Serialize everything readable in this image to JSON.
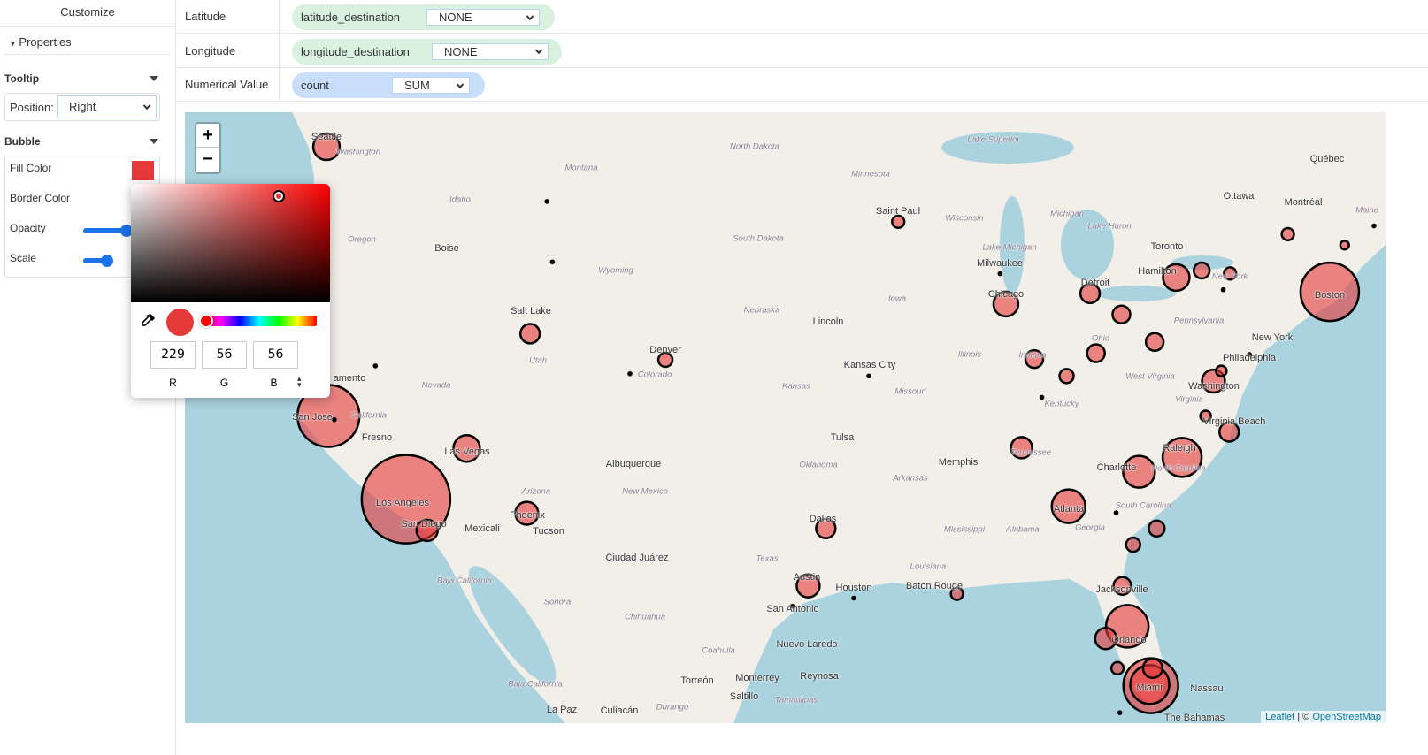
{
  "sidebar": {
    "customize": "Customize",
    "properties": "Properties",
    "tooltip": {
      "title": "Tooltip",
      "position_label": "Position:",
      "position_value": "Right"
    },
    "bubble": {
      "title": "Bubble",
      "fill_color_label": "Fill Color",
      "border_color_label": "Border Color",
      "opacity_label": "Opacity",
      "scale_label": "Scale",
      "fill_color": "#e53838",
      "opacity": 0.9,
      "scale": 0.45
    }
  },
  "fields": [
    {
      "label": "Latitude",
      "field": "latitude_destination",
      "agg": "NONE",
      "color": "#d9f2e0"
    },
    {
      "label": "Longitude",
      "field": "longitude_destination",
      "agg": "NONE",
      "color": "#d9f2e0"
    },
    {
      "label": "Numerical Value",
      "field": "count",
      "agg": "SUM",
      "color": "#c9defa"
    }
  ],
  "picker": {
    "r": "229",
    "g": "56",
    "b": "56",
    "r_label": "R",
    "g_label": "G",
    "b_label": "B",
    "mode_icon": "updown-icon"
  },
  "map": {
    "zoom_in": "+",
    "zoom_out": "−",
    "attribution_leaflet": "Leaflet",
    "attribution_sep": " | © ",
    "attribution_osm": "OpenStreetMap",
    "cities": [
      "Seattle",
      "Boise",
      "Salt Lake",
      "amento",
      "San Jose",
      "Fresno",
      "Las Vegas",
      "Los Angeles",
      "Mexicali",
      "Phoenix",
      "Tucson",
      "Albuquerque",
      "Denver",
      "Ciudad Juárez",
      "Lincoln",
      "Kansas City",
      "Tulsa",
      "Dallas",
      "Austin",
      "Houston",
      "San Antonio",
      "Nuevo Laredo",
      "Monterrey",
      "Reynosa",
      "Torreón",
      "Saltillo",
      "Culiacán",
      "La Paz",
      "Memphis",
      "Baton Rouge",
      "Jacksonville",
      "Atlanta",
      "Charlotte",
      "Raleigh",
      "Virginia Beach",
      "Washington",
      "Philadelphia",
      "New York",
      "Boston",
      "Chicago",
      "Milwaukee",
      "Detroit",
      "Toronto",
      "Hamilton",
      "Ottawa",
      "Montréal",
      "Québec",
      "Saint Paul",
      "Nassau",
      "The Bahamas",
      "Orlando",
      "Miami",
      "San Diego"
    ],
    "regions": [
      "Washington",
      "Oregon",
      "Idaho",
      "Montana",
      "North Dakota",
      "South Dakota",
      "Wyoming",
      "Nebraska",
      "Utah",
      "Colorado",
      "Nevada",
      "California",
      "Arizona",
      "New Mexico",
      "Kansas",
      "Oklahoma",
      "Texas",
      "Minnesota",
      "Iowa",
      "Wisconsin",
      "Michigan",
      "Illinois",
      "Missouri",
      "Arkansas",
      "Mississippi",
      "Alabama",
      "Louisiana",
      "Kentucky",
      "Tennessee",
      "Georgia",
      "Ohio",
      "Indiana",
      "Pennsylvania",
      "West Virginia",
      "Virginia",
      "North Carolina",
      "South Carolina",
      "New York",
      "Maine",
      "Baja California",
      "Sonora",
      "Chihuahua",
      "Coahuila",
      "Durango",
      "Tamaulipas",
      "Baja California",
      "Lake Superior",
      "Lake Michigan",
      "Lake Huron"
    ],
    "bubbles": [
      {
        "lat": 47.6,
        "lon": -122.3,
        "count": 56
      },
      {
        "lat": 37.5,
        "lon": -122.2,
        "count": 306
      },
      {
        "lat": 34.05,
        "lon": -118.24,
        "count": 625
      },
      {
        "lat": 32.72,
        "lon": -117.16,
        "count": 36
      },
      {
        "lat": 36.17,
        "lon": -115.14,
        "count": 56
      },
      {
        "lat": 40.76,
        "lon": -111.9,
        "count": 30
      },
      {
        "lat": 33.45,
        "lon": -112.07,
        "count": 42
      },
      {
        "lat": 39.74,
        "lon": -104.99,
        "count": 16
      },
      {
        "lat": 44.95,
        "lon": -93.1,
        "count": 12
      },
      {
        "lat": 41.9,
        "lon": -87.6,
        "count": 49
      },
      {
        "lat": 42.3,
        "lon": -83.3,
        "count": 30
      },
      {
        "lat": 41.5,
        "lon": -81.7,
        "count": 25
      },
      {
        "lat": 40.0,
        "lon": -83.0,
        "count": 25
      },
      {
        "lat": 39.77,
        "lon": -86.15,
        "count": 25
      },
      {
        "lat": 39.1,
        "lon": -84.5,
        "count": 16
      },
      {
        "lat": 40.44,
        "lon": -80.0,
        "count": 25
      },
      {
        "lat": 42.9,
        "lon": -78.9,
        "count": 56
      },
      {
        "lat": 43.16,
        "lon": -77.6,
        "count": 20
      },
      {
        "lat": 43.05,
        "lon": -76.15,
        "count": 12
      },
      {
        "lat": 44.5,
        "lon": -73.2,
        "count": 12
      },
      {
        "lat": 44.1,
        "lon": -70.3,
        "count": 6
      },
      {
        "lat": 42.36,
        "lon": -71.06,
        "count": 272
      },
      {
        "lat": 38.9,
        "lon": -77.0,
        "count": 42
      },
      {
        "lat": 39.3,
        "lon": -76.6,
        "count": 9
      },
      {
        "lat": 37.5,
        "lon": -77.4,
        "count": 9
      },
      {
        "lat": 36.85,
        "lon": -76.2,
        "count": 30
      },
      {
        "lat": 35.8,
        "lon": -78.6,
        "count": 121
      },
      {
        "lat": 35.2,
        "lon": -80.8,
        "count": 81
      },
      {
        "lat": 36.2,
        "lon": -86.8,
        "count": 36
      },
      {
        "lat": 33.75,
        "lon": -84.4,
        "count": 90
      },
      {
        "lat": 32.8,
        "lon": -79.9,
        "count": 20
      },
      {
        "lat": 32.1,
        "lon": -81.1,
        "count": 16
      },
      {
        "lat": 30.3,
        "lon": -81.65,
        "count": 25
      },
      {
        "lat": 28.5,
        "lon": -81.4,
        "count": 144
      },
      {
        "lat": 27.95,
        "lon": -82.5,
        "count": 36
      },
      {
        "lat": 26.6,
        "lon": -81.9,
        "count": 12
      },
      {
        "lat": 25.8,
        "lon": -80.2,
        "count": 240
      },
      {
        "lat": 25.85,
        "lon": -80.25,
        "count": 121
      },
      {
        "lat": 26.6,
        "lon": -80.1,
        "count": 30
      },
      {
        "lat": 32.8,
        "lon": -96.8,
        "count": 30
      },
      {
        "lat": 30.3,
        "lon": -97.7,
        "count": 42
      },
      {
        "lat": 29.95,
        "lon": -90.1,
        "count": 12
      },
      {
        "lat": 39.1,
        "lon": -94.6,
        "count": 2
      },
      {
        "lat": 29.76,
        "lon": -95.37,
        "count": 2
      },
      {
        "lat": 29.4,
        "lon": -98.5,
        "count": 2
      },
      {
        "lat": 39.5,
        "lon": -119.8,
        "count": 2
      },
      {
        "lat": 45.68,
        "lon": -111.04,
        "count": 2
      },
      {
        "lat": 43.48,
        "lon": -110.76,
        "count": 2
      },
      {
        "lat": 39.19,
        "lon": -106.8,
        "count": 2
      },
      {
        "lat": 43.04,
        "lon": -87.9,
        "count": 2
      },
      {
        "lat": 38.25,
        "lon": -85.76,
        "count": 2
      },
      {
        "lat": 42.44,
        "lon": -76.5,
        "count": 2
      },
      {
        "lat": 39.95,
        "lon": -75.16,
        "count": 2
      },
      {
        "lat": 44.8,
        "lon": -68.8,
        "count": 2
      },
      {
        "lat": 33.47,
        "lon": -81.97,
        "count": 2
      },
      {
        "lat": 24.55,
        "lon": -81.78,
        "count": 2
      },
      {
        "lat": 37.35,
        "lon": -121.9,
        "count": 2
      }
    ]
  }
}
